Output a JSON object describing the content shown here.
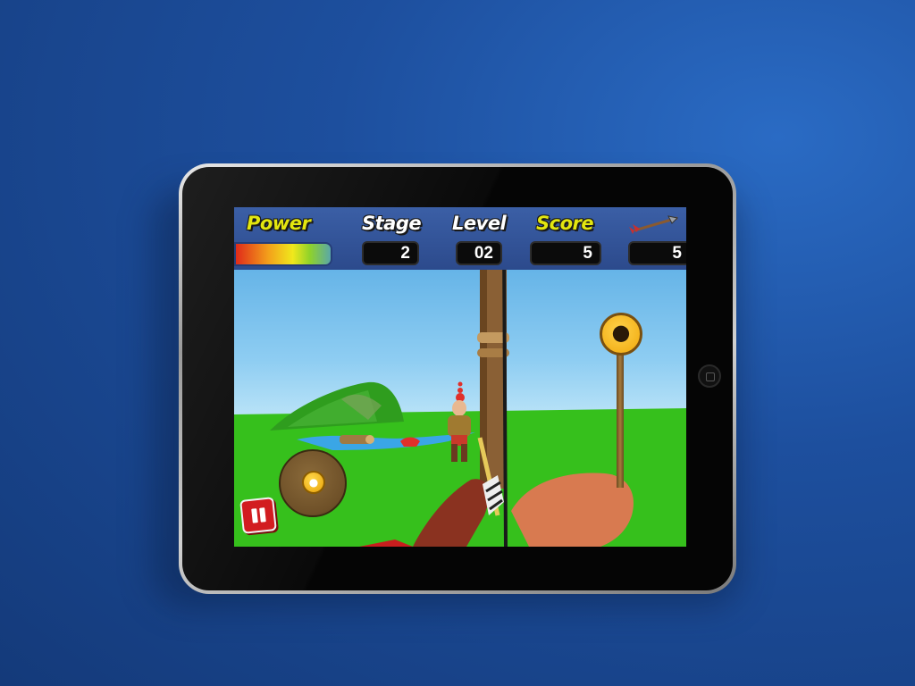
{
  "hud": {
    "power_label": "Power",
    "stage_label": "Stage",
    "level_label": "Level",
    "score_label": "Score",
    "stage_value": "2",
    "level_value": "02",
    "score_value": "5",
    "arrows_value": "5"
  },
  "icons": {
    "arrow": "arrow-icon",
    "pause": "pause-icon",
    "apple": "apple-icon"
  },
  "colors": {
    "background": "#1d4f9e",
    "hud_bar": "#2c4a8c",
    "label_yellow": "#e3e60f",
    "pause_red": "#d21c20",
    "grass": "#39c21a",
    "sky": "#8ecdf2"
  }
}
